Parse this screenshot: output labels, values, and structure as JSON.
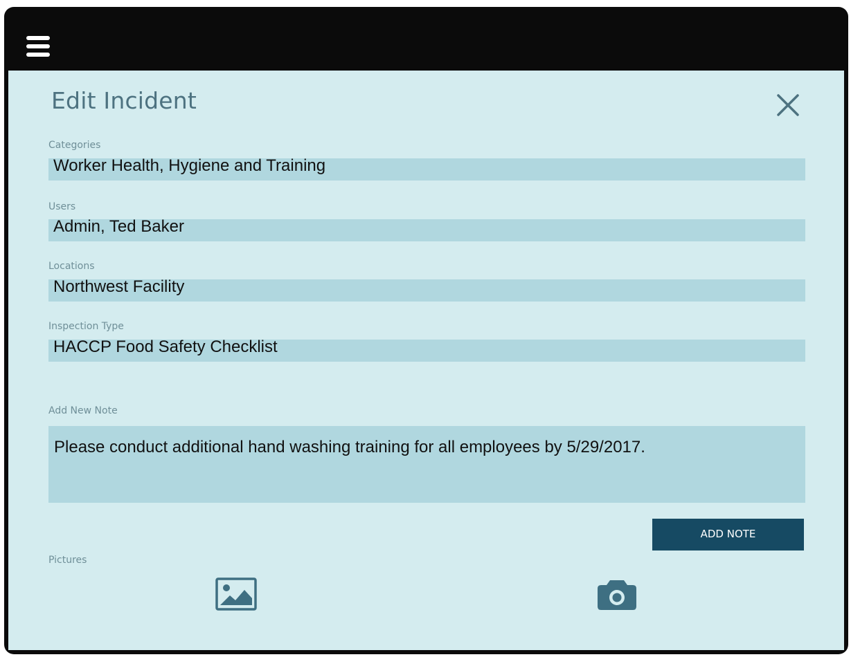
{
  "header": {
    "menu_icon": "hamburger-menu-icon"
  },
  "dialog": {
    "title": "Edit Incident",
    "close_icon": "close-icon"
  },
  "fields": {
    "categories": {
      "label": "Categories",
      "value": "Worker Health, Hygiene and Training"
    },
    "users": {
      "label": "Users",
      "value": "Admin, Ted Baker"
    },
    "locations": {
      "label": "Locations",
      "value": "Northwest Facility"
    },
    "inspection_type": {
      "label": "Inspection Type",
      "value": "HACCP Food Safety Checklist"
    }
  },
  "note": {
    "label": "Add New Note",
    "value": "Please conduct additional hand washing training for all employees by 5/29/2017.",
    "button_label": "ADD NOTE"
  },
  "pictures": {
    "label": "Pictures",
    "gallery_icon": "image-gallery-icon",
    "camera_icon": "camera-icon"
  },
  "colors": {
    "background": "#d4ecef",
    "field": "#b0d7df",
    "title": "#4d7280",
    "accent": "#164a63",
    "icon": "#3e6f82"
  }
}
